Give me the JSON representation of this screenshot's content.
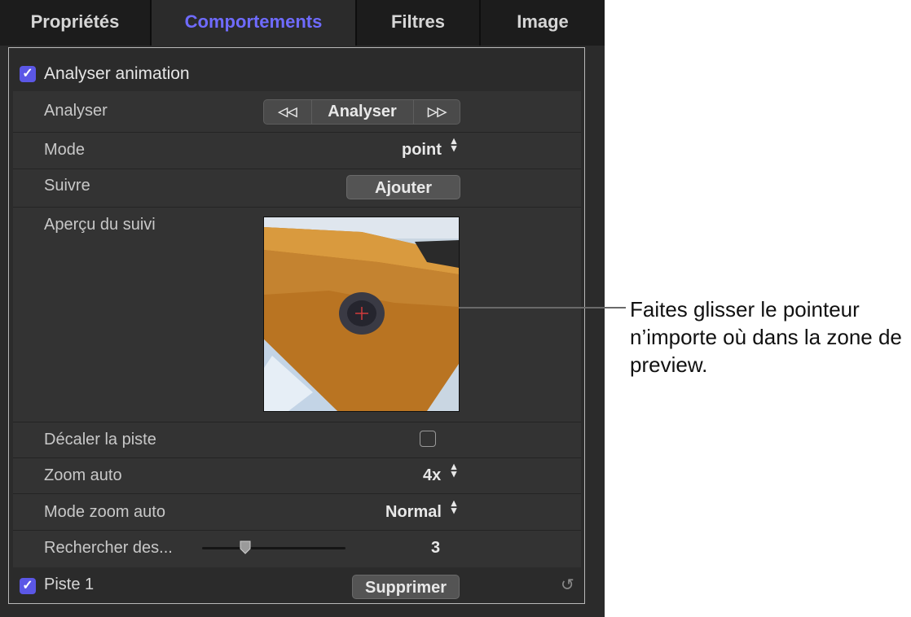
{
  "tabs": [
    "Propriétés",
    "Comportements",
    "Filtres",
    "Image"
  ],
  "header": {
    "label": "Analyser animation"
  },
  "analyze": {
    "label": "Analyser",
    "back_glyph": "◁◁",
    "button_label": "Analyser",
    "forward_glyph": "▷▷"
  },
  "mode": {
    "label": "Mode",
    "value": "point",
    "glyph": "⌃⌄"
  },
  "follow": {
    "label": "Suivre",
    "button_label": "Ajouter"
  },
  "preview": {
    "label": "Aperçu du suivi"
  },
  "offset": {
    "label": "Décaler la piste"
  },
  "zoom": {
    "label": "Zoom auto",
    "value": "4x"
  },
  "zoom_mode": {
    "label": "Mode zoom auto",
    "value": "Normal"
  },
  "search": {
    "label": "Rechercher des...",
    "value": "3",
    "slider_level": 0.3
  },
  "track": {
    "label": "Piste 1",
    "button_label": "Supprimer",
    "reset_glyph": "↺"
  },
  "callout": {
    "text": "Faites glisser le pointeur n’importe où dans la zone de preview."
  },
  "colors": {
    "accent": "#5b57e6",
    "active_tab": "#6f6bff",
    "panel": "#2b2b2b"
  }
}
